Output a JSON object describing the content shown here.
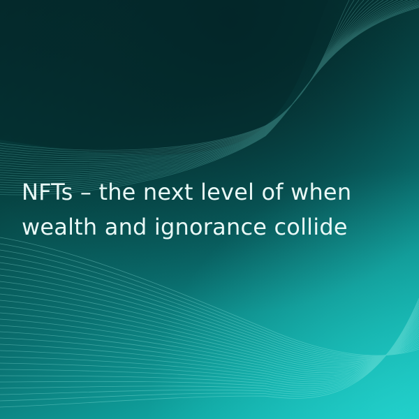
{
  "headline": {
    "line1": "NFTs – the next level of when",
    "line2": "wealth and ignorance collide"
  },
  "colors": {
    "background_dark": "#052a2d",
    "background_mid": "#0a7070",
    "background_light": "#1ac9c5",
    "text": "#e9f8f6",
    "wave_lines": "#7fe6dc"
  }
}
